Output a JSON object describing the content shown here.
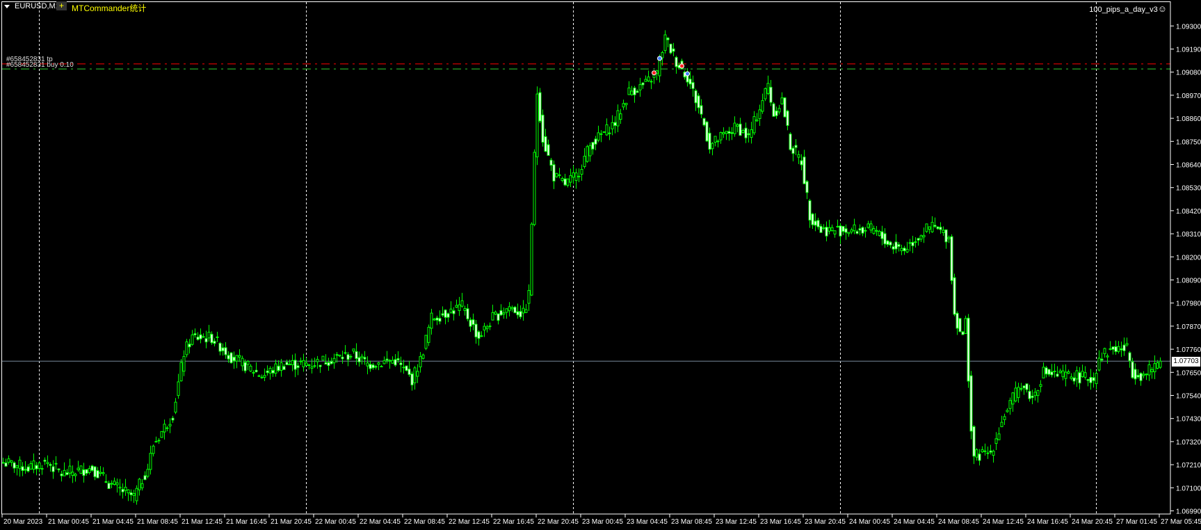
{
  "header": {
    "symbol_timeframe": "EURUSD,M15",
    "plus_button": "+",
    "commander_label": "MTCommander统计",
    "indicator_label": "100_pips_a_day_v3",
    "indicator_icon": "smiley-icon"
  },
  "orders": {
    "tp_label": "#658452831 tp",
    "buy_label": "#658452831 buy 0.10",
    "tp_price": 1.09119,
    "buy_price": 1.09095,
    "tp_color": "#ff0000",
    "buy_color": "#32cd32"
  },
  "current_price": {
    "value": "1.07703",
    "price": 1.07703
  },
  "colors": {
    "background": "#000000",
    "candle": "#00ff00",
    "bull_fill": "#000000",
    "bear_fill": "#ffffff",
    "grid": "#ffffff",
    "bid_line": "#778899"
  },
  "chart_data": {
    "type": "candlestick",
    "symbol": "EURUSD",
    "timeframe": "M15",
    "ylim": [
      1.0699,
      1.093
    ],
    "price_labels": [
      "1.09300",
      "1.09190",
      "1.09080",
      "1.08970",
      "1.08860",
      "1.08750",
      "1.08640",
      "1.08530",
      "1.08420",
      "1.08310",
      "1.08200",
      "1.08090",
      "1.07980",
      "1.07870",
      "1.07760",
      "1.07650",
      "1.07540",
      "1.07430",
      "1.07320",
      "1.07210",
      "1.07100",
      "1.06990"
    ],
    "time_labels": [
      "20 Mar 2023",
      "21 Mar 00:45",
      "21 Mar 04:45",
      "21 Mar 08:45",
      "21 Mar 12:45",
      "21 Mar 16:45",
      "21 Mar 20:45",
      "22 Mar 00:45",
      "22 Mar 04:45",
      "22 Mar 08:45",
      "22 Mar 12:45",
      "22 Mar 16:45",
      "22 Mar 20:45",
      "23 Mar 00:45",
      "23 Mar 04:45",
      "23 Mar 08:45",
      "23 Mar 12:45",
      "23 Mar 16:45",
      "23 Mar 20:45",
      "24 Mar 00:45",
      "24 Mar 04:45",
      "24 Mar 08:45",
      "24 Mar 12:45",
      "24 Mar 16:45",
      "24 Mar 20:45",
      "27 Mar 01:45",
      "27 Mar 05:45"
    ],
    "day_separator_bars": [
      13,
      109,
      205,
      301,
      393
    ],
    "bars_total": 417,
    "close_path": [
      [
        0,
        1.07221
      ],
      [
        9,
        1.07195
      ],
      [
        16,
        1.07221
      ],
      [
        21,
        1.07166
      ],
      [
        32,
        1.07195
      ],
      [
        38,
        1.07122
      ],
      [
        47,
        1.07056
      ],
      [
        52,
        1.07195
      ],
      [
        54,
        1.07305
      ],
      [
        61,
        1.07451
      ],
      [
        65,
        1.07743
      ],
      [
        68,
        1.07816
      ],
      [
        75,
        1.07816
      ],
      [
        82,
        1.07725
      ],
      [
        93,
        1.07634
      ],
      [
        101,
        1.07689
      ],
      [
        110,
        1.07689
      ],
      [
        118,
        1.07714
      ],
      [
        126,
        1.07736
      ],
      [
        131,
        1.07689
      ],
      [
        141,
        1.07707
      ],
      [
        147,
        1.07616
      ],
      [
        150,
        1.07707
      ],
      [
        154,
        1.07908
      ],
      [
        165,
        1.07963
      ],
      [
        171,
        1.07816
      ],
      [
        176,
        1.07908
      ],
      [
        182,
        1.07963
      ],
      [
        187,
        1.07926
      ],
      [
        189,
        1.08017
      ],
      [
        190,
        1.08365
      ],
      [
        192,
        1.08986
      ],
      [
        194,
        1.08767
      ],
      [
        198,
        1.08584
      ],
      [
        202,
        1.08547
      ],
      [
        206,
        1.08584
      ],
      [
        211,
        1.0873
      ],
      [
        220,
        1.0884
      ],
      [
        225,
        1.08986
      ],
      [
        231,
        1.09022
      ],
      [
        235,
        1.09077
      ],
      [
        238,
        1.09242
      ],
      [
        242,
        1.09132
      ],
      [
        246,
        1.09059
      ],
      [
        249,
        1.08949
      ],
      [
        251,
        1.08876
      ],
      [
        254,
        1.0873
      ],
      [
        258,
        1.08767
      ],
      [
        264,
        1.08821
      ],
      [
        268,
        1.08767
      ],
      [
        271,
        1.08876
      ],
      [
        275,
        1.09022
      ],
      [
        277,
        1.08876
      ],
      [
        280,
        1.08949
      ],
      [
        283,
        1.0873
      ],
      [
        287,
        1.08657
      ],
      [
        290,
        1.08401
      ],
      [
        294,
        1.08328
      ],
      [
        302,
        1.08328
      ],
      [
        313,
        1.08328
      ],
      [
        319,
        1.08255
      ],
      [
        324,
        1.08237
      ],
      [
        330,
        1.0831
      ],
      [
        334,
        1.08346
      ],
      [
        340,
        1.08291
      ],
      [
        342,
        1.07926
      ],
      [
        345,
        1.07816
      ],
      [
        346,
        1.0789
      ],
      [
        348,
        1.07378
      ],
      [
        349,
        1.0725
      ],
      [
        355,
        1.07268
      ],
      [
        360,
        1.07451
      ],
      [
        366,
        1.07597
      ],
      [
        370,
        1.07524
      ],
      [
        374,
        1.07652
      ],
      [
        379,
        1.07634
      ],
      [
        385,
        1.07634
      ],
      [
        392,
        1.07616
      ],
      [
        394,
        1.07725
      ],
      [
        399,
        1.07762
      ],
      [
        404,
        1.07762
      ],
      [
        406,
        1.07652
      ],
      [
        410,
        1.07634
      ],
      [
        416,
        1.07703
      ]
    ],
    "trade_markers_bars": [
      234,
      236,
      244,
      246
    ]
  }
}
